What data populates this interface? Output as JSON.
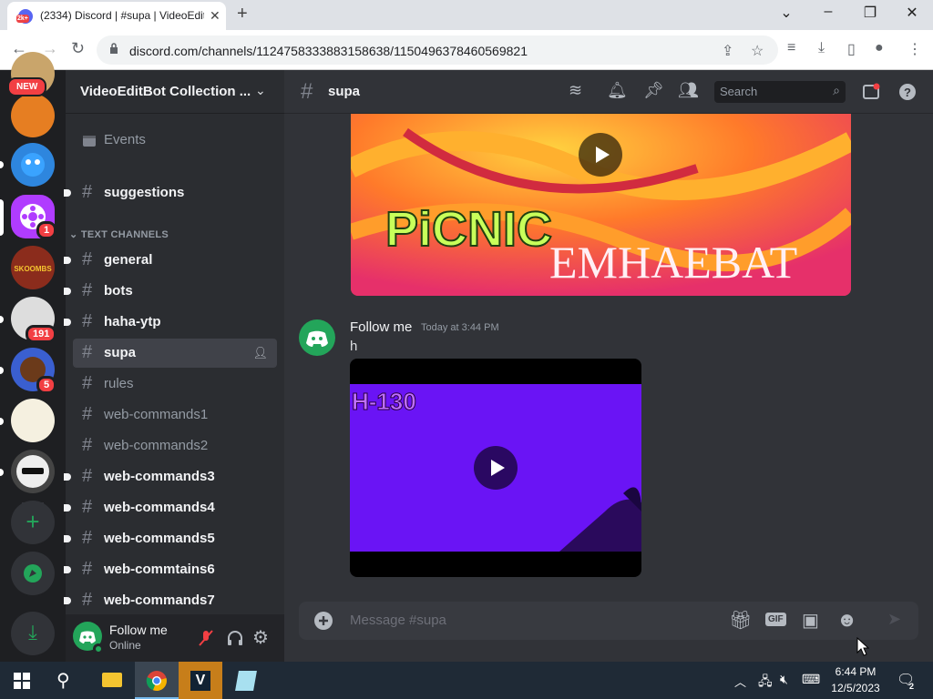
{
  "browser": {
    "tab_title": "(2334) Discord | #supa | VideoEditBot Collection",
    "tab_badge": "2k+",
    "url": "discord.com/channels/1124758333883158638/1150496378460569821"
  },
  "servers": {
    "new_label": "NEW",
    "badges": [
      "1",
      "191",
      "5"
    ]
  },
  "guild": {
    "name": "VideoEditBot Collection ...",
    "events_label": "Events",
    "category_text": "TEXT CHANNELS",
    "channels_top": [
      {
        "name": "suggestions"
      }
    ],
    "channels": [
      {
        "name": "general"
      },
      {
        "name": "bots"
      },
      {
        "name": "haha-ytp"
      },
      {
        "name": "supa"
      },
      {
        "name": "rules"
      },
      {
        "name": "web-commands1"
      },
      {
        "name": "web-commands2"
      },
      {
        "name": "web-commands3"
      },
      {
        "name": "web-commands4"
      },
      {
        "name": "web-commands5"
      },
      {
        "name": "web-commtains6"
      },
      {
        "name": "web-commands7"
      }
    ]
  },
  "user": {
    "name": "Follow me",
    "status": "Online"
  },
  "chat": {
    "channel_name": "supa",
    "search_placeholder": "Search",
    "embed1": {
      "line1": "PiCNIC",
      "line2": "EMHAEBAT"
    },
    "message": {
      "author": "Follow me",
      "timestamp": "Today at 3:44 PM",
      "text": "h"
    },
    "embed2": {
      "overlay_text": "H-130"
    },
    "composer_placeholder": "Message #supa",
    "gif_label": "GIF"
  },
  "taskbar": {
    "time": "6:44 PM",
    "date": "12/5/2023",
    "notif_count": "2"
  },
  "colors": {
    "blurple": "#5865f2",
    "green": "#23a55a",
    "red": "#f23f43",
    "purple": "#6a14f5"
  }
}
